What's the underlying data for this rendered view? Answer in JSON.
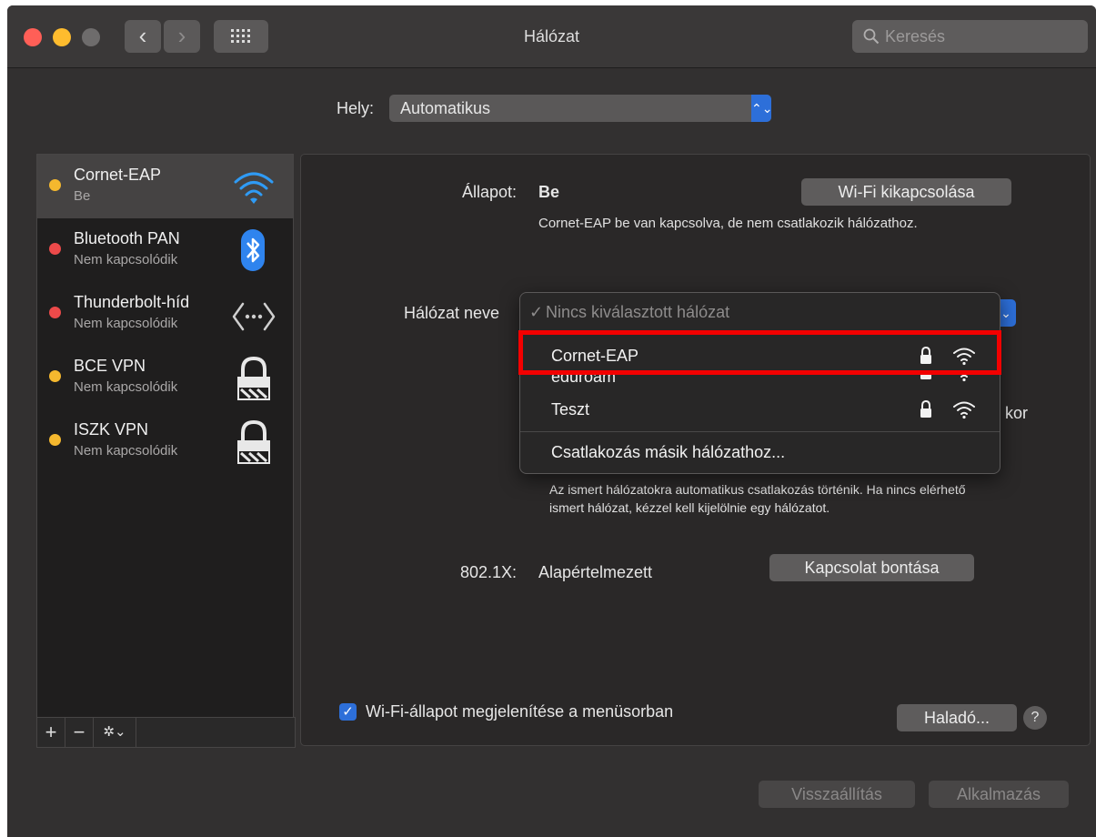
{
  "window": {
    "title": "Hálózat",
    "search_placeholder": "Keresés",
    "traffic_colors": [
      "#ff5f57",
      "#febc2e",
      "#6e6c6c"
    ]
  },
  "location": {
    "label": "Hely:",
    "value": "Automatikus"
  },
  "services": [
    {
      "name": "Cornet-EAP",
      "status": "Be",
      "dot_color": "#f5b82e",
      "icon": "wifi-icon",
      "selected": true
    },
    {
      "name": "Bluetooth PAN",
      "status": "Nem kapcsolódik",
      "dot_color": "#ec4a4a",
      "icon": "bluetooth-icon"
    },
    {
      "name": "Thunderbolt-híd",
      "status": "Nem kapcsolódik",
      "dot_color": "#ec4a4a",
      "icon": "thunderbolt-bridge-icon"
    },
    {
      "name": "BCE VPN",
      "status": "Nem kapcsolódik",
      "dot_color": "#f5b82e",
      "icon": "vpn-lock-icon"
    },
    {
      "name": "ISZK VPN",
      "status": "Nem kapcsolódik",
      "dot_color": "#f5b82e",
      "icon": "vpn-lock-icon"
    }
  ],
  "sidebar_tools": {
    "add": "+",
    "remove": "−",
    "gear": "✲⌄"
  },
  "detail": {
    "status_label": "Állapot:",
    "status_value": "Be",
    "status_desc": "Cornet-EAP be van kapcsolva, de nem csatlakozik hálózathoz.",
    "wifi_off_button": "Wi-Fi kikapcsolása",
    "network_name_label": "Hálózat neve",
    "partial_label_tail": "kor",
    "auto_join_desc": "Az ismert hálózatokra automatikus csatlakozás történik. Ha nincs elérhető ismert hálózat, kézzel kell kijelölnie egy hálózatot.",
    "dot1x_label": "802.1X:",
    "dot1x_value": "Alapértelmezett",
    "disconnect_button": "Kapcsolat bontása",
    "show_wifi_status_label": "Wi-Fi-állapot megjelenítése a menüsorban",
    "show_wifi_status_checked": true,
    "advanced_button": "Haladó...",
    "help_button": "?"
  },
  "network_menu": {
    "checkmark": "✓",
    "header": "Nincs kiválasztott hálózat",
    "networks": [
      {
        "name": "Cornet-EAP",
        "locked": true
      },
      {
        "name": "eduroam",
        "locked": true
      },
      {
        "name": "Teszt",
        "locked": true
      }
    ],
    "join_other": "Csatlakozás másik hálózathoz..."
  },
  "footer": {
    "revert_button": "Visszaállítás",
    "apply_button": "Alkalmazás"
  },
  "highlight_color": "#f30000"
}
